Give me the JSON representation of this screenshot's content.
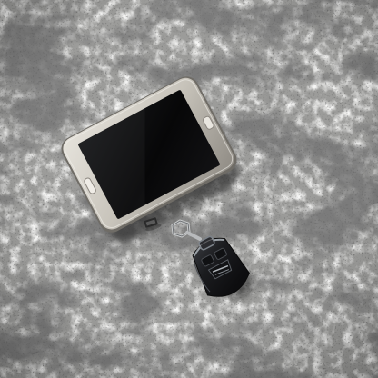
{
  "scene": {
    "surface": {
      "material": "granite",
      "base_color": "#9a9a98",
      "light_color": "#d8d8d6",
      "dark_color": "#3a3a3a"
    },
    "objects": [
      {
        "kind": "smartphone",
        "frame_color": "#c9c5bd",
        "screen_color": "#0b0b0c",
        "icon": "smartphone-icon"
      },
      {
        "kind": "car-key-fob",
        "body_color": "#1b1c1f",
        "trim_color": "#8a8f96",
        "icon": "key-fob-icon"
      },
      {
        "kind": "usb-connector",
        "color": "#2a2a2a"
      }
    ]
  }
}
